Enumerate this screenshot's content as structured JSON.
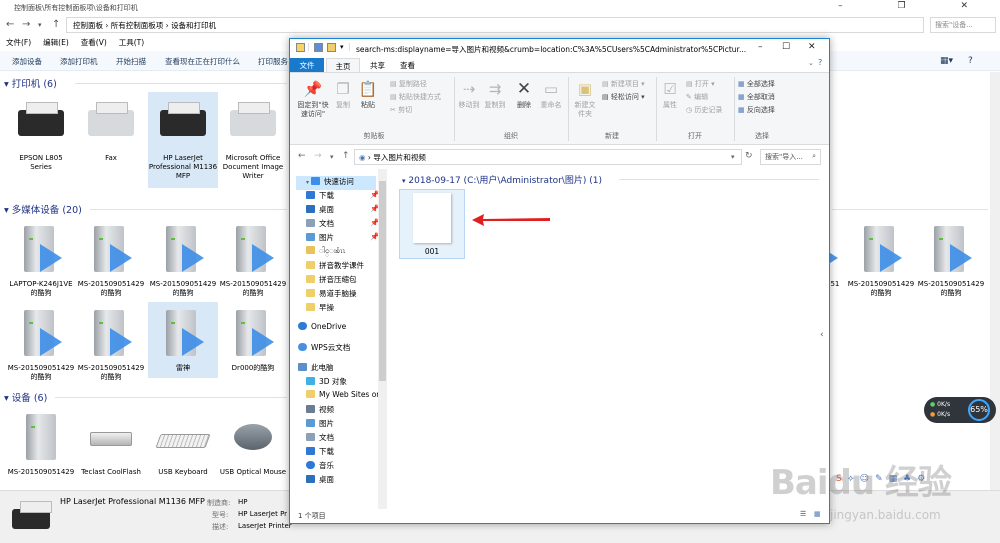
{
  "bg_window": {
    "title": "控制面板\\所有控制面板项\\设备和打印机",
    "breadcrumb": [
      "控制面板",
      "所有控制面板项",
      "设备和打印机"
    ],
    "search_placeholder": "搜索\"设备...",
    "menu": [
      "文件(F)",
      "编辑(E)",
      "查看(V)",
      "工具(T)"
    ],
    "commands": [
      "添加设备",
      "添加打印机",
      "开始扫描",
      "查看现在正在打印什么",
      "打印服务"
    ],
    "groups": {
      "printers": {
        "header": "打印机 (6)",
        "items": [
          {
            "line1": "EPSON L805",
            "line2": "Series"
          },
          {
            "line1": "Fax",
            "line2": ""
          },
          {
            "line1": "HP LaserJet",
            "line2": "Professional M1136 MFP"
          },
          {
            "line1": "Microsoft Office",
            "line2": "Document Image Writer"
          }
        ]
      },
      "media": {
        "header": "多媒体设备 (20)",
        "row1": [
          {
            "label": "LAPTOP-K246J1VE的酷狗"
          },
          {
            "label": "MS-201509051429的酷狗"
          },
          {
            "label": "MS-201509051429的酷狗"
          },
          {
            "label": "MS-201509051429的酷狗"
          }
        ],
        "row1_right": [
          {
            "label": "051"
          },
          {
            "label": "MS-201509051429的酷狗"
          },
          {
            "label": "MS-201509051429的酷狗"
          }
        ],
        "row2": [
          {
            "label": "MS-201509051429的酷狗"
          },
          {
            "label": "MS-201509051429的酷狗"
          },
          {
            "label": "雷神"
          },
          {
            "label": "Dr000的酷狗"
          }
        ]
      },
      "devices": {
        "header": "设备 (6)",
        "items": [
          {
            "label": "MS-201509051429"
          },
          {
            "label": "Teclast CoolFlash"
          },
          {
            "label": "USB Keyboard"
          },
          {
            "label": "USB Optical Mouse"
          }
        ]
      }
    },
    "details": {
      "name": "HP LaserJet Professional M1136 MFP",
      "maker_key": "制造商:",
      "maker_val": "HP",
      "model_key": "型号:",
      "model_val": "HP LaserJet Pr",
      "desc_key": "描述:",
      "desc_val": "LaserJet Printer"
    }
  },
  "explorer": {
    "title": "search-ms:displayname=导入图片和视频&crumb=location:C%3A%5CUsers%5CAdministrator%5CPictur...",
    "tabs": [
      "文件",
      "主页",
      "共享",
      "查看"
    ],
    "ribbon": {
      "pin_quick_access": "固定到\"快速访问\"",
      "copy": "复制",
      "paste": "粘贴",
      "copy_path": "复制路径",
      "paste_shortcut": "粘贴快捷方式",
      "cut": "剪切",
      "clipboard_group": "剪贴板",
      "move_to": "移动到",
      "copy_to": "复制到",
      "delete": "删除",
      "rename": "重命名",
      "organize_group": "组织",
      "new_item": "新建项目",
      "easy_access": "轻松访问",
      "new_folder": "新建文件夹",
      "new_group": "新建",
      "properties": "属性",
      "open": "打开",
      "edit": "编辑",
      "history": "历史记录",
      "open_group": "打开",
      "select_all": "全部选择",
      "select_none": "全部取消",
      "invert_selection": "反向选择",
      "select_group": "选择"
    },
    "address": "导入图片和视频",
    "search_placeholder": "搜索\"导入...",
    "nav": [
      {
        "label": "快速访问",
        "color": "#3d8ee8"
      },
      {
        "label": "下载",
        "color": "#2f78d6"
      },
      {
        "label": "桌面",
        "color": "#2c6fbd"
      },
      {
        "label": "文档",
        "color": "#8aa1b8"
      },
      {
        "label": "图片",
        "color": "#5b9bd5"
      },
      {
        "label": "ါင္းၶံၤၤ",
        "color": "#e8c25a"
      },
      {
        "label": "拼音教学课件",
        "color": "#f0cf6a"
      },
      {
        "label": "拼音压缩包",
        "color": "#f0cf6a"
      },
      {
        "label": "易道手脑操",
        "color": "#f0cf6a"
      },
      {
        "label": "早操",
        "color": "#f0cf6a"
      },
      {
        "label": "OneDrive",
        "color": "#2b7cd3"
      },
      {
        "label": "WPS云文档",
        "color": "#4a90e2"
      },
      {
        "label": "此电脑",
        "color": "#5b8fc7"
      },
      {
        "label": "3D 对象",
        "color": "#3fb1e3"
      },
      {
        "label": "My Web Sites on MSN",
        "color": "#f0cf6a"
      },
      {
        "label": "视频",
        "color": "#6a7d92"
      },
      {
        "label": "图片",
        "color": "#5b9bd5"
      },
      {
        "label": "文档",
        "color": "#8aa1b8"
      },
      {
        "label": "下载",
        "color": "#2f78d6"
      },
      {
        "label": "音乐",
        "color": "#2f78d6"
      },
      {
        "label": "桌面",
        "color": "#2c6fbd"
      }
    ],
    "group_label": "2018-09-17 (C:\\用户\\Administrator\\图片) (1)",
    "file_name": "001",
    "status": "1 个项目"
  },
  "overlay": {
    "gauge_percent": "65%",
    "up_speed": "0K/s",
    "down_speed": "0K/s",
    "watermark": "Baidu 经验",
    "watermark_sub": "jingyan.baidu.com"
  }
}
